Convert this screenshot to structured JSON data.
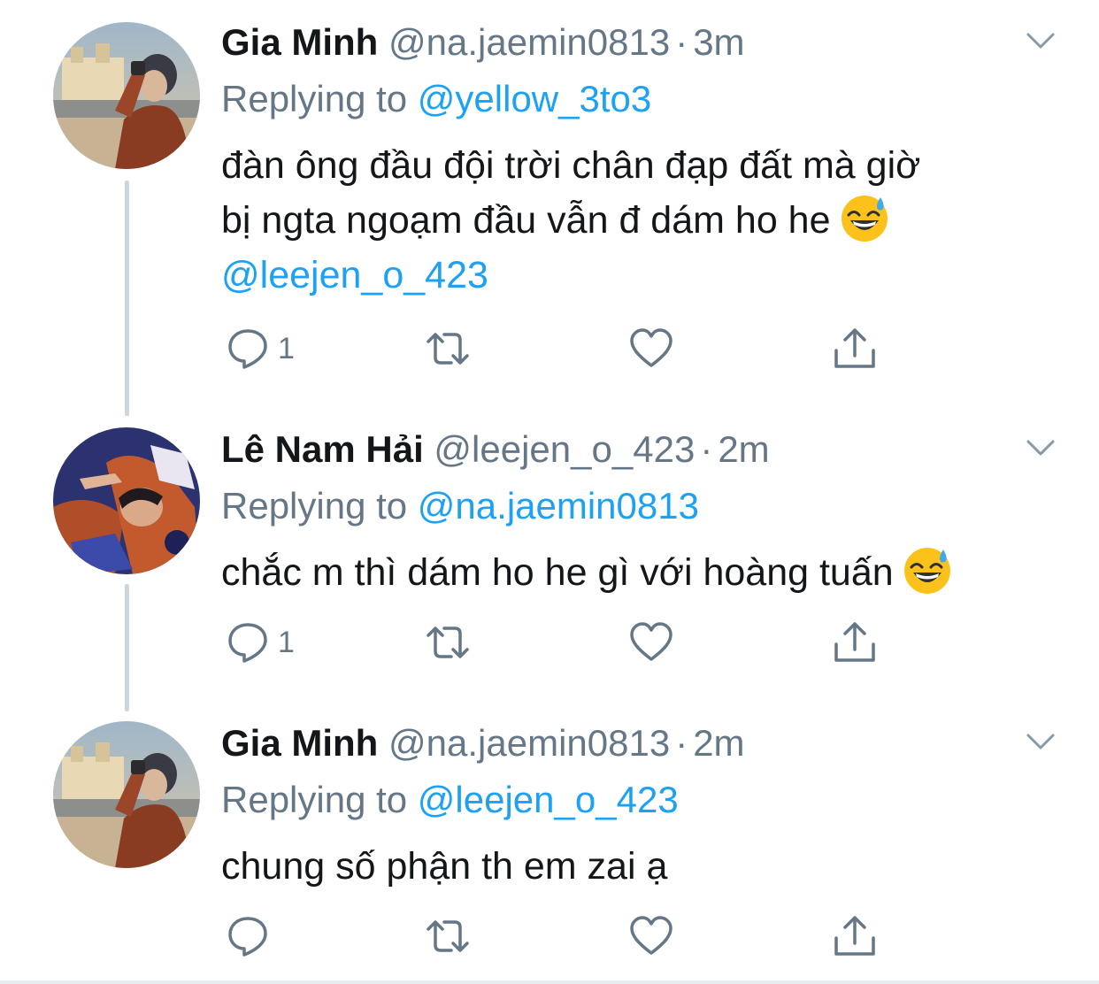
{
  "tweets": [
    {
      "name": "Gia Minh",
      "handle": "@na.jaemin0813",
      "separator": "·",
      "time": "3m",
      "replying_prefix": "Replying to",
      "replying_to": "@yellow_3to3",
      "text_line1": "đàn ông đầu đội trời chân đạp đất mà giờ",
      "text_line2": "bị ngta ngoạm đầu vẫn đ dám ho he",
      "mention_line": "@leejen_o_423",
      "emoji": "grinning-face-with-sweat",
      "reply_count": "1"
    },
    {
      "name": "Lê Nam Hải",
      "handle": "@leejen_o_423",
      "separator": "·",
      "time": "2m",
      "replying_prefix": "Replying to",
      "replying_to": "@na.jaemin0813",
      "text_line1": "chắc m thì dám ho he gì với hoàng tuấn",
      "emoji": "grinning-face-with-sweat",
      "reply_count": "1"
    },
    {
      "name": "Gia Minh",
      "handle": "@na.jaemin0813",
      "separator": "·",
      "time": "2m",
      "replying_prefix": "Replying to",
      "replying_to": "@leejen_o_423",
      "text_line1": "chung số phận th em zai ạ",
      "reply_count": ""
    }
  ],
  "colors": {
    "text": "#14171a",
    "secondary": "#657786",
    "link": "#1da1f2",
    "thread_line": "#cdd6dd",
    "icon": "#657786"
  }
}
